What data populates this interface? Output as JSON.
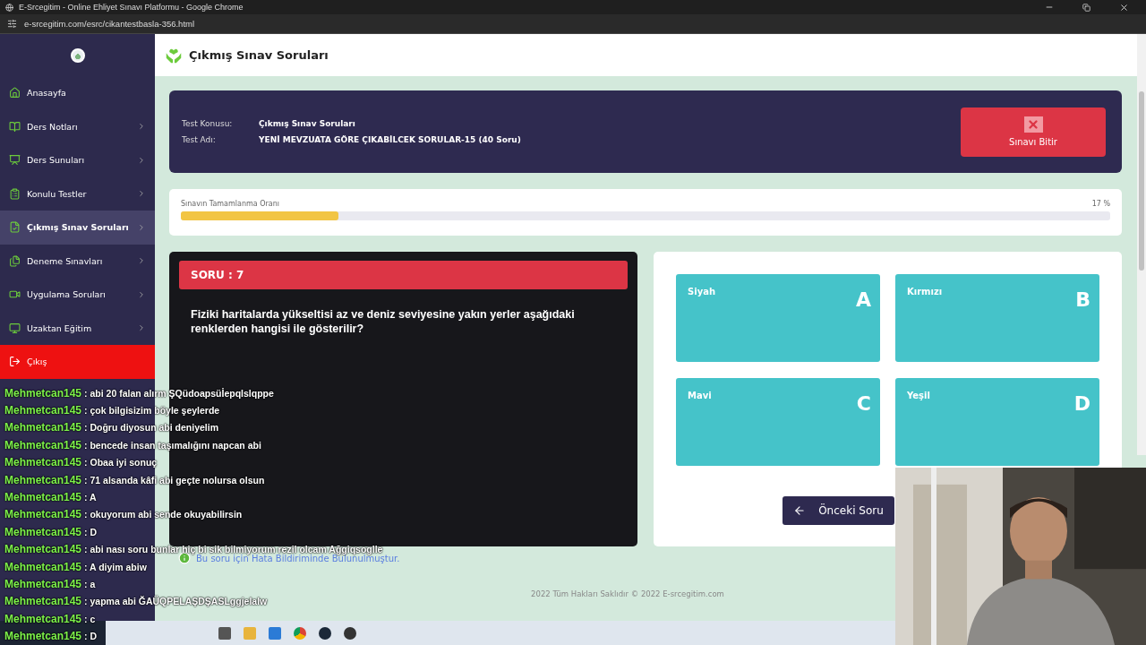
{
  "browser": {
    "title": "E-Srcegitim - Online Ehliyet Sınavı Platformu - Google Chrome",
    "url": "e-srcegitim.com/esrc/cikantestbasla-356.html"
  },
  "sidebar": {
    "items": [
      {
        "label": "Anasayfa",
        "kind": "link",
        "selected": false
      },
      {
        "label": "Ders Notları",
        "kind": "submenu",
        "selected": false
      },
      {
        "label": "Ders Sunuları",
        "kind": "submenu",
        "selected": false
      },
      {
        "label": "Konulu Testler",
        "kind": "submenu",
        "selected": false
      },
      {
        "label": "Çıkmış Sınav Soruları",
        "kind": "submenu",
        "selected": true
      },
      {
        "label": "Deneme Sınavları",
        "kind": "submenu",
        "selected": false
      },
      {
        "label": "Uygulama Soruları",
        "kind": "submenu",
        "selected": false
      },
      {
        "label": "Uzaktan Eğitim",
        "kind": "submenu",
        "selected": false
      },
      {
        "label": "Çıkış",
        "kind": "logout",
        "selected": false
      }
    ]
  },
  "page_title": "Çıkmış Sınav Soruları",
  "test_info": {
    "fields": [
      {
        "label": "Test Konusu:",
        "value": "Çıkmış Sınav Soruları"
      },
      {
        "label": "Test Adı:",
        "value": "YENİ MEVZUATA GÖRE ÇIKABİLCEK SORULAR-15 (40 Soru)"
      }
    ],
    "finish_button": "Sınavı Bitir"
  },
  "progress": {
    "label": "Sınavın Tamamlanma Oranı",
    "value": "17 %",
    "level": 0.17
  },
  "question": {
    "number": "SORU : 7",
    "text": "Fiziki haritalarda yükseltisi az ve deniz seviyesine yakın yerler aşağıdaki renklerden hangisi ile gösterilir?"
  },
  "answers": [
    {
      "text": "Siyah",
      "letter": "A"
    },
    {
      "text": "Kırmızı",
      "letter": "B"
    },
    {
      "text": "Mavi",
      "letter": "C"
    },
    {
      "text": "Yeşil",
      "letter": "D"
    }
  ],
  "prev_button": "Önceki Soru",
  "error_note": "Bu soru için Hata Bildiriminde Bulunulmuştur.",
  "footer": "2022 Tüm Hakları Saklıdır © 2022 E-srcegitim.com",
  "chat": [
    {
      "user": "Mehmetcan145",
      "message": ": abi 20 falan alırm ŞQüdoapsüİepqlslqppe"
    },
    {
      "user": "Mehmetcan145",
      "message": ": çok bilgisizim böyle şeylerde"
    },
    {
      "user": "Mehmetcan145",
      "message": ": Doğru diyosun abi deniyelim"
    },
    {
      "user": "Mehmetcan145",
      "message": ": bencede insan taşımalığını napcan abi"
    },
    {
      "user": "Mehmetcan145",
      "message": ": Obaa iyi sonuç"
    },
    {
      "user": "Mehmetcan145",
      "message": ": 71 alsanda kâfi abi geçte nolursa olsun"
    },
    {
      "user": "Mehmetcan145",
      "message": ": A"
    },
    {
      "user": "Mehmetcan145",
      "message": ": okuyorum abi sende okuyabilirsin"
    },
    {
      "user": "Mehmetcan145",
      "message": ": D"
    },
    {
      "user": "Mehmetcan145",
      "message": ": abi nası soru bunlar hiç bi sik bilmiyorum rezil olcam Ağgiqsoglle"
    },
    {
      "user": "Mehmetcan145",
      "message": ": A diyim abiw"
    },
    {
      "user": "Mehmetcan145",
      "message": ": a"
    },
    {
      "user": "Mehmetcan145",
      "message": ": yapma abi ĞAÜQPELAŞDŞASLggjelalw"
    },
    {
      "user": "Mehmetcan145",
      "message": ": c"
    },
    {
      "user": "Mehmetcan145",
      "message": ": D"
    }
  ]
}
